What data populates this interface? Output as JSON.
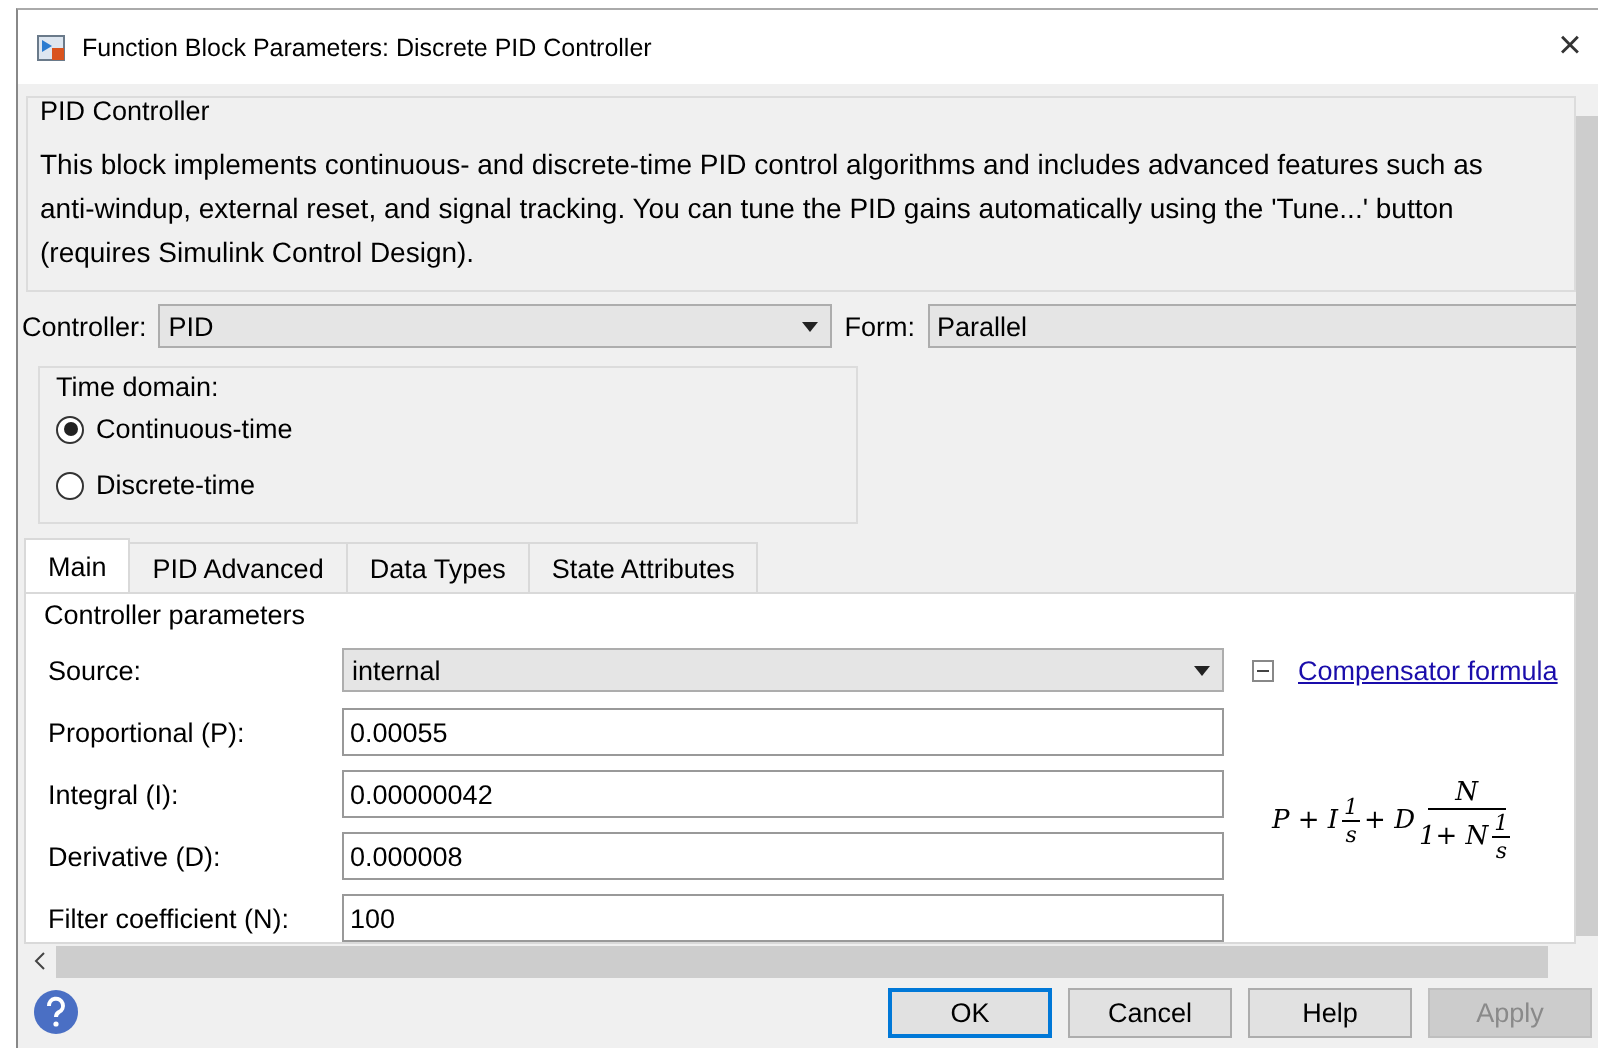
{
  "window": {
    "title": "Function Block Parameters: Discrete PID Controller",
    "close": "×"
  },
  "block": {
    "title": "PID Controller",
    "description": "This block implements continuous- and discrete-time PID control algorithms and includes advanced features such as anti-windup, external reset, and signal tracking. You can tune the PID gains automatically using the 'Tune...' button (requires Simulink Control Design)."
  },
  "controller": {
    "label": "Controller:",
    "value": "PID"
  },
  "form": {
    "label": "Form:",
    "value": "Parallel"
  },
  "time_domain": {
    "title": "Time domain:",
    "options": [
      {
        "label": "Continuous-time",
        "selected": true
      },
      {
        "label": "Discrete-time",
        "selected": false
      }
    ]
  },
  "tabs": [
    {
      "label": "Main",
      "selected": true
    },
    {
      "label": "PID Advanced",
      "selected": false
    },
    {
      "label": "Data Types",
      "selected": false
    },
    {
      "label": "State Attributes",
      "selected": false
    }
  ],
  "parameters": {
    "title": "Controller parameters",
    "rows": [
      {
        "kind": "dropdown",
        "label": "Source:",
        "value": "internal"
      },
      {
        "kind": "field",
        "label": "Proportional (P):",
        "value": "0.00055"
      },
      {
        "kind": "field",
        "label": "Integral (I):",
        "value": "0.00000042"
      },
      {
        "kind": "field",
        "label": "Derivative (D):",
        "value": "0.000008"
      },
      {
        "kind": "field",
        "label": "Filter coefficient (N):",
        "value": "100"
      }
    ]
  },
  "compensator": {
    "expanded": true,
    "link": "Compensator formula",
    "formula": {
      "lead": "P + I",
      "f1_num": "1",
      "f1_den": "s",
      "mid": "+ D",
      "f2_num": "N",
      "f2_den": "1+ N",
      "f3_num": "1",
      "f3_den": "s"
    }
  },
  "buttons": [
    {
      "label": "OK",
      "disabled": false,
      "default": true
    },
    {
      "label": "Cancel",
      "disabled": false,
      "default": false
    },
    {
      "label": "Help",
      "disabled": false,
      "default": false
    },
    {
      "label": "Apply",
      "disabled": true,
      "default": false
    }
  ]
}
